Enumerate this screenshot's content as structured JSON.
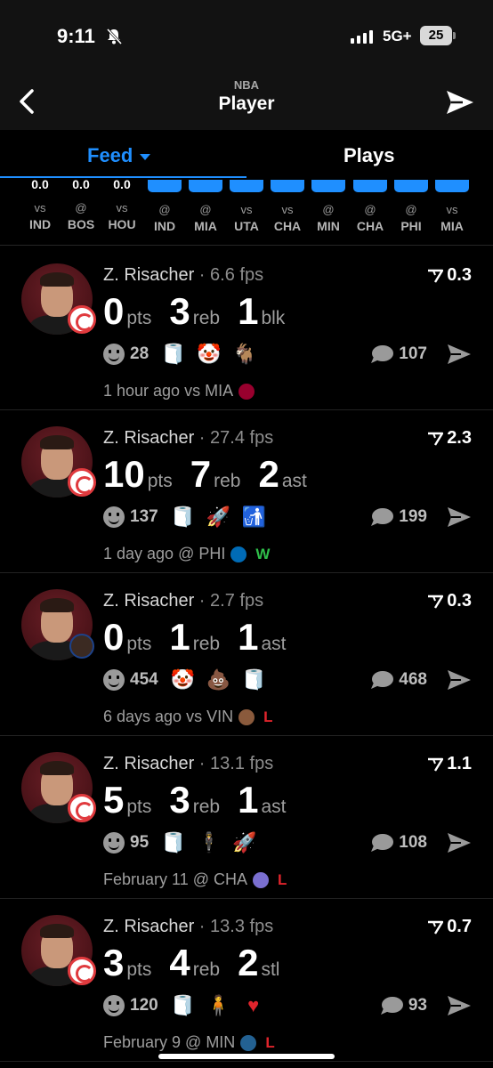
{
  "status_bar": {
    "time": "9:11",
    "network": "5G+",
    "battery": "25"
  },
  "header": {
    "league": "NBA",
    "title": "Player"
  },
  "tabs": {
    "feed": "Feed",
    "plays": "Plays"
  },
  "game_strip": [
    {
      "value": "0.0",
      "prefix": "vs",
      "opponent": "IND",
      "bar": false
    },
    {
      "value": "0.0",
      "prefix": "@",
      "opponent": "BOS",
      "bar": false
    },
    {
      "value": "0.0",
      "prefix": "vs",
      "opponent": "HOU",
      "bar": false
    },
    {
      "value": "",
      "prefix": "@",
      "opponent": "IND",
      "bar": true
    },
    {
      "value": "",
      "prefix": "@",
      "opponent": "MIA",
      "bar": true
    },
    {
      "value": "",
      "prefix": "vs",
      "opponent": "UTA",
      "bar": true
    },
    {
      "value": "",
      "prefix": "vs",
      "opponent": "CHA",
      "bar": true
    },
    {
      "value": "",
      "prefix": "@",
      "opponent": "MIN",
      "bar": true
    },
    {
      "value": "",
      "prefix": "@",
      "opponent": "CHA",
      "bar": true
    },
    {
      "value": "",
      "prefix": "@",
      "opponent": "PHI",
      "bar": true
    },
    {
      "value": "",
      "prefix": "vs",
      "opponent": "MIA",
      "bar": true
    }
  ],
  "feed": [
    {
      "player": "Z. Risacher",
      "fps": "6.6 fps",
      "score": "0.3",
      "stats": [
        {
          "num": "0",
          "label": "pts"
        },
        {
          "num": "3",
          "label": "reb"
        },
        {
          "num": "1",
          "label": "blk"
        }
      ],
      "reactions_count": "28",
      "emojis": [
        {
          "char": "🧻",
          "kind": "tp"
        },
        {
          "char": "🤡",
          "kind": ""
        },
        {
          "char": "🐐",
          "kind": ""
        }
      ],
      "comments": "107",
      "time": "1 hour ago vs MIA",
      "opp_color": "#98002e",
      "result": "",
      "result_color": "",
      "badge": "team"
    },
    {
      "player": "Z. Risacher",
      "fps": "27.4 fps",
      "score": "2.3",
      "stats": [
        {
          "num": "10",
          "label": "pts"
        },
        {
          "num": "7",
          "label": "reb"
        },
        {
          "num": "2",
          "label": "ast"
        }
      ],
      "reactions_count": "137",
      "emojis": [
        {
          "char": "🧻",
          "kind": "tp"
        },
        {
          "char": "🚀",
          "kind": ""
        },
        {
          "char": "🚮",
          "kind": ""
        }
      ],
      "comments": "199",
      "time": "1 day ago @ PHI",
      "opp_color": "#006bb6",
      "result": "W",
      "result_color": "#2fbf4a",
      "badge": "team"
    },
    {
      "player": "Z. Risacher",
      "fps": "2.7 fps",
      "score": "0.3",
      "stats": [
        {
          "num": "0",
          "label": "pts"
        },
        {
          "num": "1",
          "label": "reb"
        },
        {
          "num": "1",
          "label": "ast"
        }
      ],
      "reactions_count": "454",
      "emojis": [
        {
          "char": "🤡",
          "kind": ""
        },
        {
          "char": "💩",
          "kind": ""
        },
        {
          "char": "🧻",
          "kind": "tp"
        }
      ],
      "comments": "468",
      "time": "6 days ago vs VIN",
      "opp_color": "#8a5a3c",
      "result": "L",
      "result_color": "#e0242c",
      "badge": "opp"
    },
    {
      "player": "Z. Risacher",
      "fps": "13.1 fps",
      "score": "1.1",
      "stats": [
        {
          "num": "5",
          "label": "pts"
        },
        {
          "num": "3",
          "label": "reb"
        },
        {
          "num": "1",
          "label": "ast"
        }
      ],
      "reactions_count": "95",
      "emojis": [
        {
          "char": "🧻",
          "kind": "tp"
        },
        {
          "char": "🕴",
          "kind": ""
        },
        {
          "char": "🚀",
          "kind": ""
        }
      ],
      "comments": "108",
      "time": "February 11 @ CHA",
      "opp_color": "#7a6fd0",
      "result": "L",
      "result_color": "#e0242c",
      "badge": "team"
    },
    {
      "player": "Z. Risacher",
      "fps": "13.3 fps",
      "score": "0.7",
      "stats": [
        {
          "num": "3",
          "label": "pts"
        },
        {
          "num": "4",
          "label": "reb"
        },
        {
          "num": "2",
          "label": "stl"
        }
      ],
      "reactions_count": "120",
      "emojis": [
        {
          "char": "🧻",
          "kind": "tp"
        },
        {
          "char": "🧍",
          "kind": ""
        },
        {
          "char": "♥",
          "kind": "heart"
        }
      ],
      "comments": "93",
      "time": "February 9 @ MIN",
      "opp_color": "#236192",
      "result": "L",
      "result_color": "#e0242c",
      "badge": "team"
    }
  ]
}
